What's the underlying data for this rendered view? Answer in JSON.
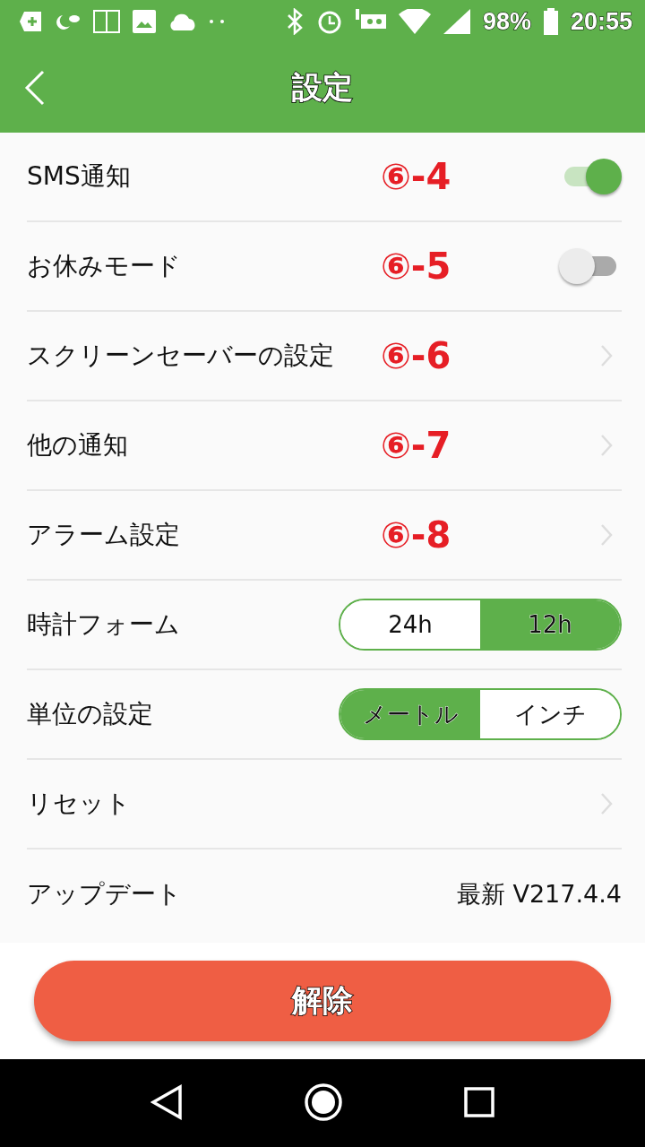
{
  "status_bar": {
    "battery": "98%",
    "time": "20:55"
  },
  "toolbar": {
    "title": "設定"
  },
  "rows": [
    {
      "kind": "toggle",
      "label": "SMS通知",
      "annotation": "⑥-4",
      "on": true
    },
    {
      "kind": "toggle",
      "label": "お休みモード",
      "annotation": "⑥-5",
      "on": false
    },
    {
      "kind": "link",
      "label": "スクリーンセーバーの設定",
      "annotation": "⑥-6"
    },
    {
      "kind": "link",
      "label": "他の通知",
      "annotation": "⑥-7"
    },
    {
      "kind": "link",
      "label": "アラーム設定",
      "annotation": "⑥-8"
    },
    {
      "kind": "segmented",
      "label": "時計フォーム",
      "options": [
        {
          "label": "24h",
          "selected": false
        },
        {
          "label": "12h",
          "selected": true
        }
      ]
    },
    {
      "kind": "segmented",
      "label": "単位の設定",
      "options": [
        {
          "label": "メートル",
          "selected": true
        },
        {
          "label": "インチ",
          "selected": false
        }
      ]
    },
    {
      "kind": "link",
      "label": "リセット"
    },
    {
      "kind": "value",
      "label": "アップデート",
      "value": "最新 V217.4.4"
    }
  ],
  "action_button": "解除"
}
